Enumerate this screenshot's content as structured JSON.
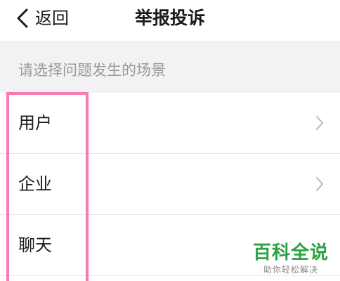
{
  "nav": {
    "back_label": "返回",
    "title": "举报投诉",
    "back_icon": "chevron-left-icon"
  },
  "section": {
    "header": "请选择问题发生的场景"
  },
  "list": {
    "items": [
      {
        "label": "用户",
        "has_chevron": true
      },
      {
        "label": "企业",
        "has_chevron": true
      },
      {
        "label": "聊天",
        "has_chevron": false
      }
    ],
    "chevron_icon": "chevron-right-icon"
  },
  "highlight": {
    "color": "#f77bb0"
  },
  "watermark": {
    "title": "百科全说",
    "subtitle": "助你轻松解决",
    "color": "#2ba245"
  }
}
